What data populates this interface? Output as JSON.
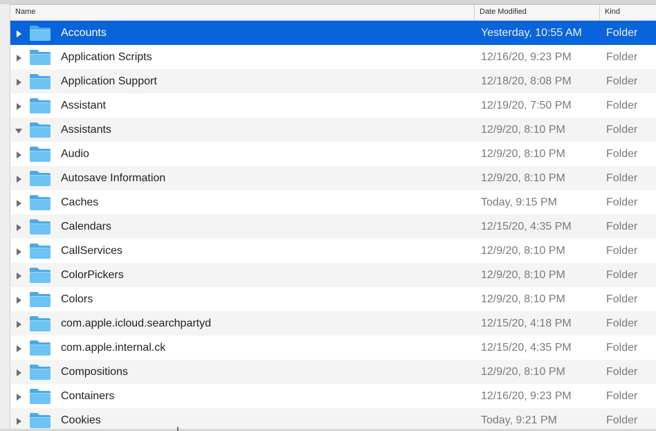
{
  "header": {
    "name_label": "Name",
    "date_label": "Date Modified",
    "kind_label": "Kind"
  },
  "colors": {
    "selection": "#0a64d9",
    "stripe": "#f4f4f4",
    "folder_body": "#6dc3f3",
    "folder_tab": "#4aa9e6"
  },
  "icons": {
    "disclosure_collapsed": "chevron-right-icon",
    "disclosure_expanded": "chevron-down-icon",
    "folder": "folder-icon"
  },
  "rows": [
    {
      "name": "Accounts",
      "date": "Yesterday, 10:55 AM",
      "kind": "Folder",
      "selected": true,
      "expanded": false
    },
    {
      "name": "Application Scripts",
      "date": "12/16/20, 9:23 PM",
      "kind": "Folder",
      "selected": false,
      "expanded": false
    },
    {
      "name": "Application Support",
      "date": "12/18/20, 8:08 PM",
      "kind": "Folder",
      "selected": false,
      "expanded": false
    },
    {
      "name": "Assistant",
      "date": "12/19/20, 7:50 PM",
      "kind": "Folder",
      "selected": false,
      "expanded": false
    },
    {
      "name": "Assistants",
      "date": "12/9/20, 8:10 PM",
      "kind": "Folder",
      "selected": false,
      "expanded": true
    },
    {
      "name": "Audio",
      "date": "12/9/20, 8:10 PM",
      "kind": "Folder",
      "selected": false,
      "expanded": false
    },
    {
      "name": "Autosave Information",
      "date": "12/9/20, 8:10 PM",
      "kind": "Folder",
      "selected": false,
      "expanded": false
    },
    {
      "name": "Caches",
      "date": "Today, 9:15 PM",
      "kind": "Folder",
      "selected": false,
      "expanded": false
    },
    {
      "name": "Calendars",
      "date": "12/15/20, 4:35 PM",
      "kind": "Folder",
      "selected": false,
      "expanded": false
    },
    {
      "name": "CallServices",
      "date": "12/9/20, 8:10 PM",
      "kind": "Folder",
      "selected": false,
      "expanded": false
    },
    {
      "name": "ColorPickers",
      "date": "12/9/20, 8:10 PM",
      "kind": "Folder",
      "selected": false,
      "expanded": false
    },
    {
      "name": "Colors",
      "date": "12/9/20, 8:10 PM",
      "kind": "Folder",
      "selected": false,
      "expanded": false
    },
    {
      "name": "com.apple.icloud.searchpartyd",
      "date": "12/15/20, 4:18 PM",
      "kind": "Folder",
      "selected": false,
      "expanded": false
    },
    {
      "name": "com.apple.internal.ck",
      "date": "12/15/20, 4:35 PM",
      "kind": "Folder",
      "selected": false,
      "expanded": false
    },
    {
      "name": "Compositions",
      "date": "12/9/20, 8:10 PM",
      "kind": "Folder",
      "selected": false,
      "expanded": false
    },
    {
      "name": "Containers",
      "date": "12/16/20, 9:23 PM",
      "kind": "Folder",
      "selected": false,
      "expanded": false
    },
    {
      "name": "Cookies",
      "date": "Today, 9:21 PM",
      "kind": "Folder",
      "selected": false,
      "expanded": false
    }
  ]
}
